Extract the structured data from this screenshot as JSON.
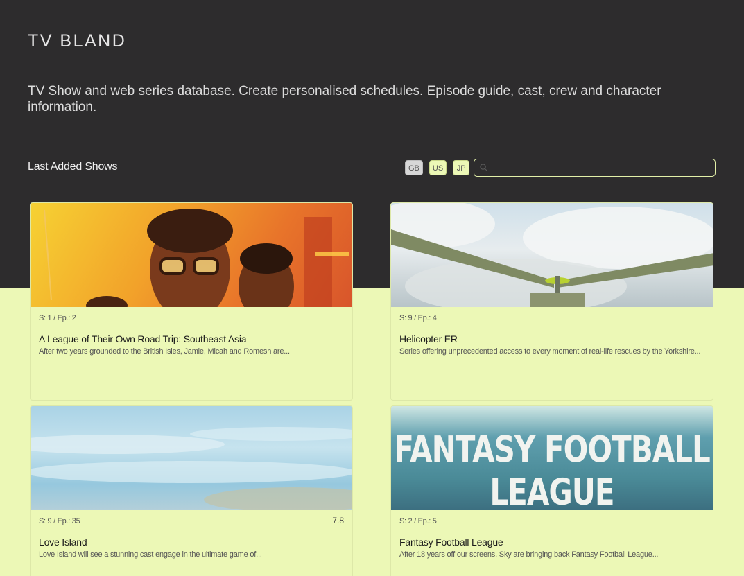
{
  "header": {
    "brand": "TV BLAND",
    "tagline": "TV Show and web series database. Create personalised schedules. Episode guide, cast, crew and character information."
  },
  "section": {
    "title": "Last Added Shows",
    "filters": [
      "GB",
      "US",
      "JP"
    ],
    "search_placeholder": ""
  },
  "shows": [
    {
      "meta": "S: 1 / Ep.: 2",
      "title": "A League of Their Own Road Trip: Southeast Asia",
      "description": "After two years grounded to the British Isles, Jamie, Micah and Romesh are..."
    },
    {
      "meta": "S: 9 / Ep.: 4",
      "title": "Helicopter ER",
      "description": "Series offering unprecedented access to every moment of real-life rescues by the Yorkshire..."
    },
    {
      "meta": "S: 9 / Ep.: 35",
      "rating": "7.8",
      "title": "Love Island",
      "description": "Love Island will see a stunning cast engage in the ultimate game of..."
    },
    {
      "meta": "S: 2 / Ep.: 5",
      "title": "Fantasy Football League",
      "description": "After 18 years off our screens, Sky are bringing back Fantasy Football League...",
      "poster_text": "FANTASY FOOTBALL LEAGUE"
    }
  ],
  "colors": {
    "hero": "#2d2c2d",
    "accent": "#ecf8b6"
  }
}
